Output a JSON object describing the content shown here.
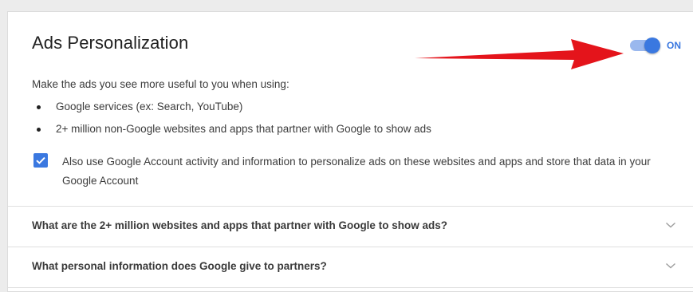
{
  "section": {
    "title": "Ads Personalization",
    "toggle": {
      "state_label": "ON",
      "on": true
    },
    "intro": "Make the ads you see more useful to you when using:",
    "bullets": [
      "Google services (ex: Search, YouTube)",
      "2+ million non-Google websites and apps that partner with Google to show ads"
    ],
    "checkbox": {
      "checked": true,
      "label": "Also use Google Account activity and information to personalize ads on these websites and apps and store that data in your Google Account"
    }
  },
  "faq": [
    {
      "question": "What are the 2+ million websites and apps that partner with Google to show ads?"
    },
    {
      "question": "What personal information does Google give to partners?"
    }
  ],
  "icons": {
    "toggle": "toggle-switch",
    "checkbox": "check-icon",
    "expand": "chevron-down-icon",
    "annotation": "red-arrow"
  },
  "colors": {
    "accent": "#3a78e0",
    "annotation": "#e4141b"
  }
}
